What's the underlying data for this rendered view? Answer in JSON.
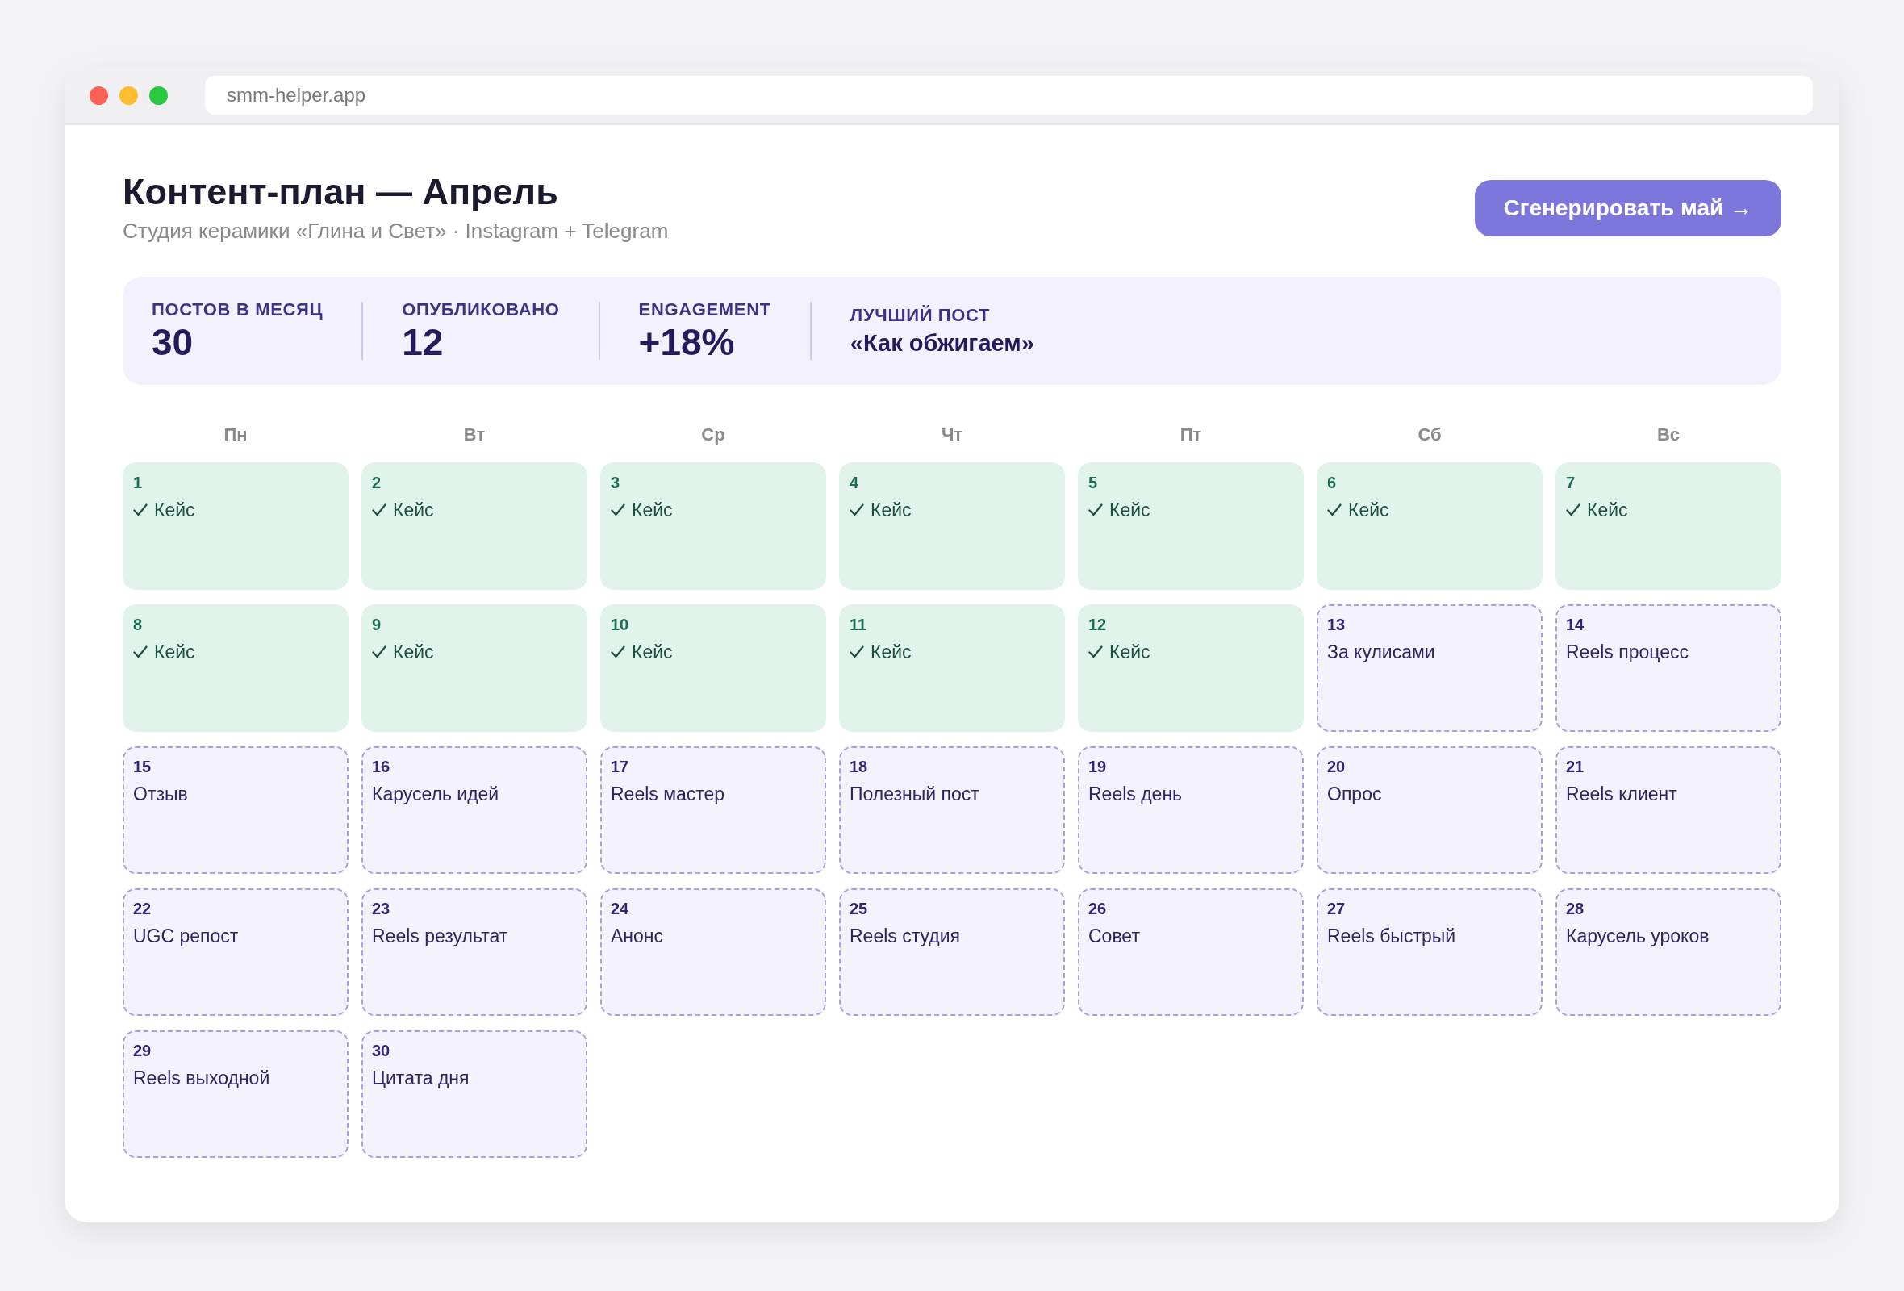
{
  "browser": {
    "url": "smm-helper.app"
  },
  "header": {
    "title": "Контент-план — Апрель",
    "subtitle": "Студия керамики «Глина и Свет» · Instagram + Telegram",
    "action_button": "Сгенерировать май →"
  },
  "stats": [
    {
      "kind": "number",
      "label": "ПОСТОВ В МЕСЯЦ",
      "value": "30"
    },
    {
      "kind": "number",
      "label": "ОПУБЛИКОВАНО",
      "value": "12"
    },
    {
      "kind": "number",
      "label": "ENGAGEMENT",
      "value": "+18%"
    },
    {
      "kind": "text",
      "label": "ЛУЧШИЙ ПОСТ",
      "value": "«Как обжигаем»"
    }
  ],
  "calendar": {
    "weekdays": [
      "Пн",
      "Вт",
      "Ср",
      "Чт",
      "Пт",
      "Сб",
      "Вс"
    ],
    "days": [
      {
        "day": "1",
        "title": "Кейс",
        "published": true
      },
      {
        "day": "2",
        "title": "Кейс",
        "published": true
      },
      {
        "day": "3",
        "title": "Кейс",
        "published": true
      },
      {
        "day": "4",
        "title": "Кейс",
        "published": true
      },
      {
        "day": "5",
        "title": "Кейс",
        "published": true
      },
      {
        "day": "6",
        "title": "Кейс",
        "published": true
      },
      {
        "day": "7",
        "title": "Кейс",
        "published": true
      },
      {
        "day": "8",
        "title": "Кейс",
        "published": true
      },
      {
        "day": "9",
        "title": "Кейс",
        "published": true
      },
      {
        "day": "10",
        "title": "Кейс",
        "published": true
      },
      {
        "day": "11",
        "title": "Кейс",
        "published": true
      },
      {
        "day": "12",
        "title": "Кейс",
        "published": true
      },
      {
        "day": "13",
        "title": "За кулисами",
        "published": false
      },
      {
        "day": "14",
        "title": "Reels процесс",
        "published": false
      },
      {
        "day": "15",
        "title": "Отзыв",
        "published": false
      },
      {
        "day": "16",
        "title": "Карусель идей",
        "published": false
      },
      {
        "day": "17",
        "title": "Reels мастер",
        "published": false
      },
      {
        "day": "18",
        "title": "Полезный пост",
        "published": false
      },
      {
        "day": "19",
        "title": "Reels день",
        "published": false
      },
      {
        "day": "20",
        "title": "Опрос",
        "published": false
      },
      {
        "day": "21",
        "title": "Reels клиент",
        "published": false
      },
      {
        "day": "22",
        "title": "UGC репост",
        "published": false
      },
      {
        "day": "23",
        "title": "Reels результат",
        "published": false
      },
      {
        "day": "24",
        "title": "Анонс",
        "published": false
      },
      {
        "day": "25",
        "title": "Reels студия",
        "published": false
      },
      {
        "day": "26",
        "title": "Совет",
        "published": false
      },
      {
        "day": "27",
        "title": "Reels быстрый",
        "published": false
      },
      {
        "day": "28",
        "title": "Карусель уроков",
        "published": false
      },
      {
        "day": "29",
        "title": "Reels выходной",
        "published": false
      },
      {
        "day": "30",
        "title": "Цитата дня",
        "published": false
      }
    ]
  }
}
